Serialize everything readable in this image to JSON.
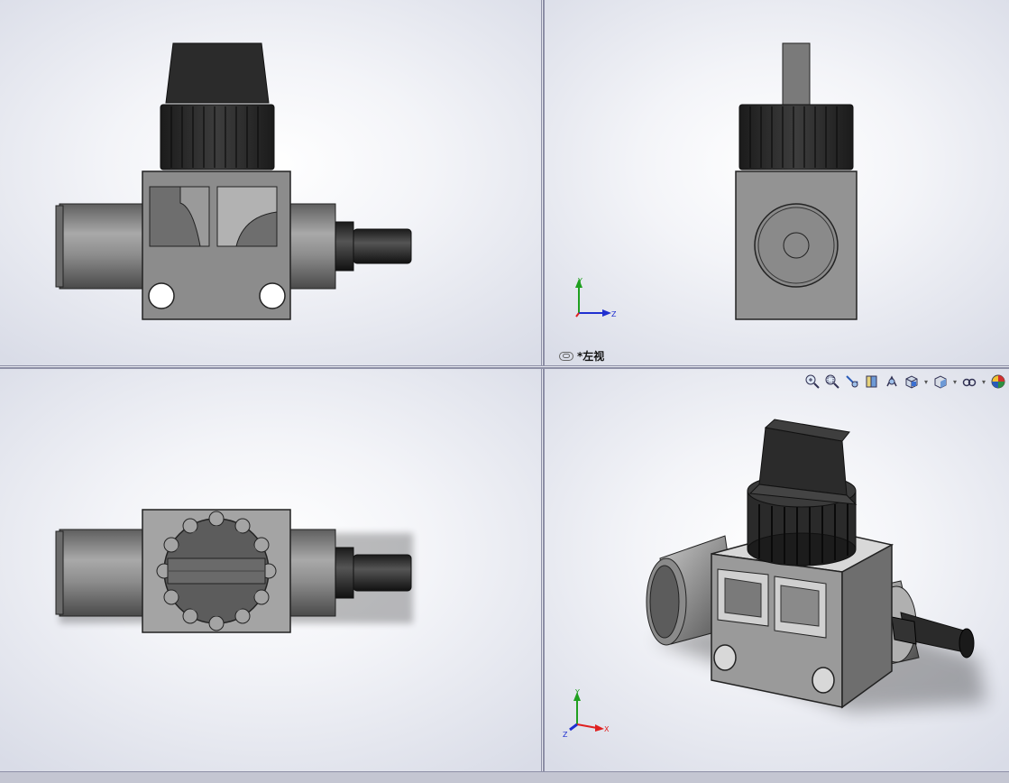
{
  "viewports": {
    "front": {
      "name": "front"
    },
    "left": {
      "name": "left",
      "label": "*左视"
    },
    "top": {
      "name": "top"
    },
    "iso": {
      "name": "isometric"
    }
  },
  "triad": {
    "x": "X",
    "y": "Y",
    "z": "Z"
  },
  "toolbar": {
    "items": [
      "zoom-to-fit-icon",
      "zoom-to-area-icon",
      "previous-view-icon",
      "section-view-icon",
      "dynamic-annotation-icon",
      "view-orientation-icon",
      "display-style-icon",
      "hide-show-items-icon",
      "edit-appearance-icon"
    ]
  },
  "colors": {
    "accent_axis_x": "#e02020",
    "accent_axis_y": "#20a020",
    "accent_axis_z": "#2030d0",
    "background": "#f3f4f8",
    "part_gray": "#8a8a8a"
  }
}
